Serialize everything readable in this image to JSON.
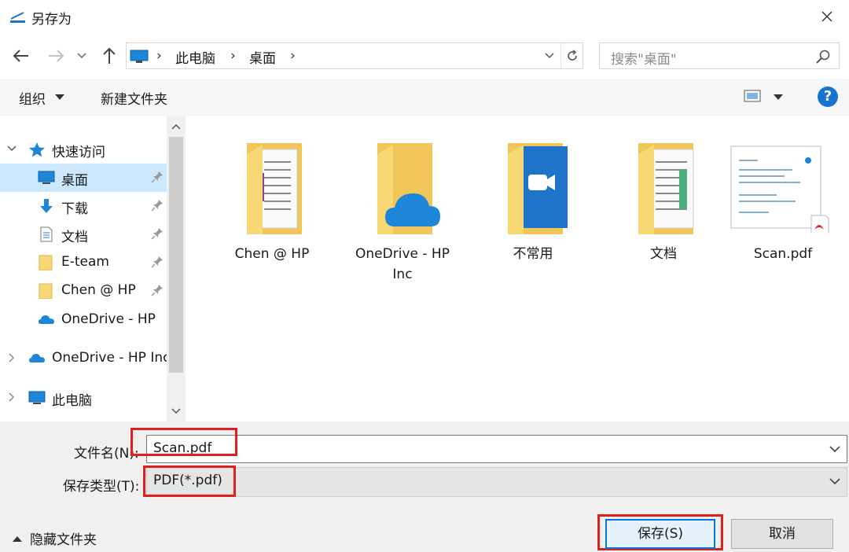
{
  "window": {
    "title": "另存为"
  },
  "nav": {
    "breadcrumb": [
      "此电脑",
      "桌面"
    ],
    "search_placeholder": "搜索\"桌面\""
  },
  "toolbar": {
    "organize": "组织",
    "new_folder": "新建文件夹",
    "help": "?"
  },
  "sidebar": {
    "quick_access": "快速访问",
    "items": [
      {
        "label": "桌面",
        "icon": "desktop-icon",
        "pinned": true
      },
      {
        "label": "下载",
        "icon": "download-icon",
        "pinned": true
      },
      {
        "label": "文档",
        "icon": "document-icon",
        "pinned": true
      },
      {
        "label": "E-team",
        "icon": "folder-icon",
        "pinned": true
      },
      {
        "label": "Chen @ HP",
        "icon": "folder-icon",
        "pinned": true
      },
      {
        "label": "OneDrive - HP",
        "icon": "onedrive-icon",
        "pinned": false
      }
    ],
    "onedrive_root": "OneDrive - HP Inc",
    "this_pc": "此电脑"
  },
  "files": [
    {
      "name": "Chen @ HP",
      "type": "folder-docs"
    },
    {
      "name": "OneDrive - HP Inc",
      "type": "folder-onedrive"
    },
    {
      "name": "不常用",
      "type": "folder-zoom"
    },
    {
      "name": "文档",
      "type": "folder-docs"
    },
    {
      "name": "Scan.pdf",
      "type": "pdf"
    }
  ],
  "form": {
    "filename_label": "文件名(N):",
    "filename_value": "Scan.pdf",
    "filetype_label": "保存类型(T):",
    "filetype_value": "PDF(*.pdf)"
  },
  "footer": {
    "hide_folders": "隐藏文件夹",
    "save": "保存(S)",
    "cancel": "取消"
  },
  "colors": {
    "accent": "#0078d7",
    "highlight": "#e02020",
    "folder": "#f8d775",
    "selected": "#cce8ff"
  }
}
